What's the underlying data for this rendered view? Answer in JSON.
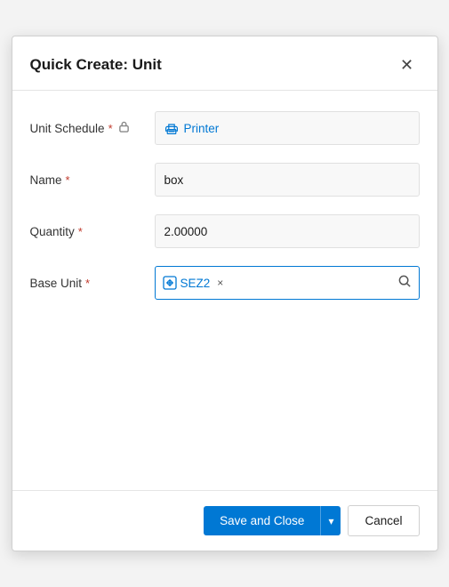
{
  "dialog": {
    "title": "Quick Create: Unit",
    "close_label": "×"
  },
  "fields": {
    "unit_schedule": {
      "label": "Unit Schedule",
      "required": true,
      "locked": true,
      "value": "Printer",
      "type": "lookup"
    },
    "name": {
      "label": "Name",
      "required": true,
      "value": "box",
      "type": "text"
    },
    "quantity": {
      "label": "Quantity",
      "required": true,
      "value": "2.00000",
      "type": "number"
    },
    "base_unit": {
      "label": "Base Unit",
      "required": true,
      "tag_value": "SEZ2",
      "type": "lookup-tag"
    }
  },
  "footer": {
    "save_label": "Save and Close",
    "cancel_label": "Cancel"
  },
  "icons": {
    "required_star": "*",
    "lock": "🔒",
    "close": "✕",
    "chevron_down": "▾",
    "search": "🔍",
    "tag_close": "×"
  }
}
